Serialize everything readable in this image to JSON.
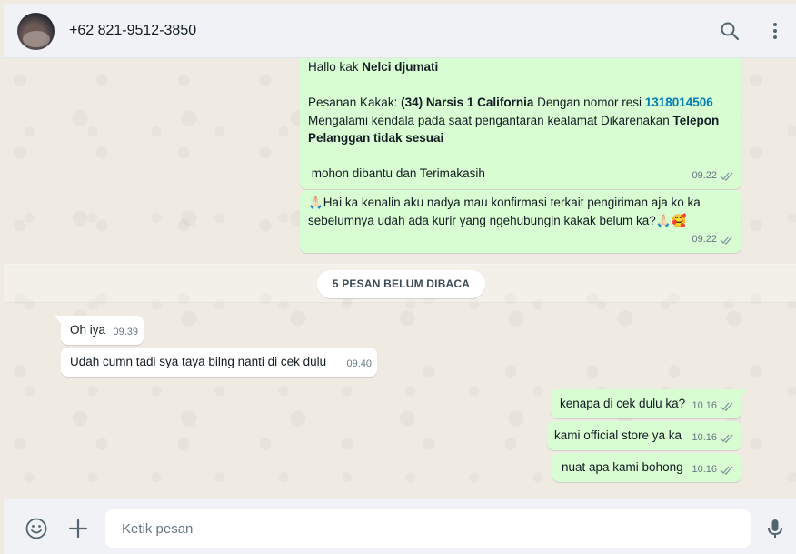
{
  "header": {
    "contact_name": "+62 821-9512-3850"
  },
  "messages_top": {
    "msg1": {
      "greeting_prefix": "Hallo kak ",
      "greeting_name": "Nelci djumati",
      "order_prefix": "Pesanan Kakak: ",
      "order_item": "(34) Narsis 1 California",
      "order_mid": " Dengan nomor resi ",
      "resi": "1318014506",
      "issue_text": "Mengalami kendala pada saat pengantaran kealamat Dikarenakan ",
      "issue_reason": "Telepon Pelanggan tidak sesuai",
      "closing": " mohon dibantu dan Terimakasih",
      "time": "09.22"
    },
    "msg2": {
      "text": "🙏🏻Hai ka kenalin aku nadya mau konfirmasi terkait pengiriman aja ko ka sebelumnya udah ada kurir yang ngehubungin kakak belum ka?🙏🏻🥰",
      "time": "09.22"
    }
  },
  "unread_divider": "5 PESAN BELUM DIBACA",
  "incoming": [
    {
      "text": "Oh iya",
      "time": "09.39"
    },
    {
      "text": "Udah cumn tadi sya taya bilng nanti di cek dulu",
      "time": "09.40"
    }
  ],
  "outgoing": [
    {
      "text": "kenapa di cek dulu ka?",
      "time": "10.16"
    },
    {
      "text": "kami official store ya ka",
      "time": "10.16"
    },
    {
      "text": "nuat apa kami bohong",
      "time": "10.16"
    }
  ],
  "composer": {
    "placeholder": "Ketik pesan"
  },
  "icons": {
    "search": "search-icon",
    "menu": "menu-icon",
    "emoji": "emoji-icon",
    "attach": "plus-icon",
    "mic": "mic-icon",
    "read_receipt": "double-check-icon"
  },
  "colors": {
    "outgoing_bubble": "#d9fdd3",
    "incoming_bubble": "#ffffff",
    "link": "#027eb5",
    "chat_bg": "#efeae2",
    "panel_bg": "#f0f2f5"
  }
}
